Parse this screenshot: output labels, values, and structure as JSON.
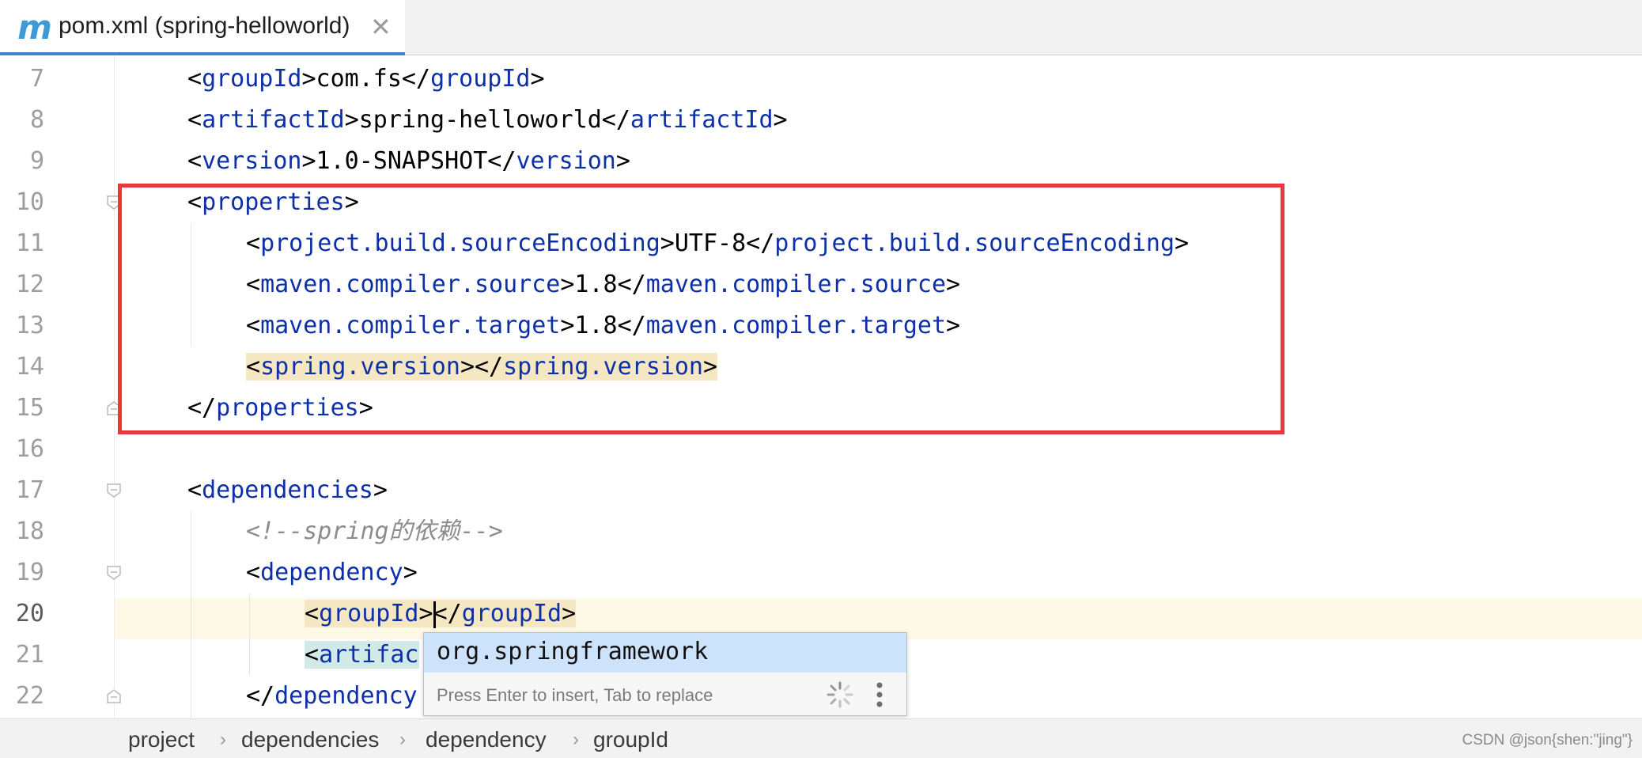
{
  "tab": {
    "icon": "maven-m-icon",
    "title": "pom.xml (spring-helloworld)",
    "close_glyph": "✕"
  },
  "editor": {
    "line_numbers": [
      "7",
      "8",
      "9",
      "10",
      "11",
      "12",
      "13",
      "14",
      "15",
      "16",
      "17",
      "18",
      "19",
      "20",
      "21",
      "22"
    ],
    "current_line": "20",
    "lines": {
      "l7": {
        "o": "<",
        "t1": "groupId",
        "c": ">com.fs</",
        "t2": "groupId",
        "e": ">"
      },
      "l8": {
        "o": "<",
        "t1": "artifactId",
        "c": ">spring-helloworld</",
        "t2": "artifactId",
        "e": ">"
      },
      "l9": {
        "o": "<",
        "t1": "version",
        "c": ">1.0-SNAPSHOT</",
        "t2": "version",
        "e": ">"
      },
      "l10": {
        "o": "<",
        "t1": "properties",
        "e": ">"
      },
      "l11": {
        "o": "<",
        "t1": "project.build.sourceEncoding",
        "c": ">UTF-8</",
        "t2": "project.build.sourceEncoding",
        "e": ">"
      },
      "l12": {
        "o": "<",
        "t1": "maven.compiler.source",
        "c": ">1.8</",
        "t2": "maven.compiler.source",
        "e": ">"
      },
      "l13": {
        "o": "<",
        "t1": "maven.compiler.target",
        "c": ">1.8</",
        "t2": "maven.compiler.target",
        "e": ">"
      },
      "l14": {
        "o": "<",
        "t1": "spring.version",
        "c": "></",
        "t2": "spring.version",
        "e": ">"
      },
      "l15": {
        "o": "</",
        "t1": "properties",
        "e": ">"
      },
      "l17": {
        "o": "<",
        "t1": "dependencies",
        "e": ">"
      },
      "l18": {
        "comment": "<!--spring的依赖-->"
      },
      "l19": {
        "o": "<",
        "t1": "dependency",
        "e": ">"
      },
      "l20": {
        "o": "<",
        "t1": "groupId",
        "c1": ">",
        "c2": "</",
        "t2": "groupId",
        "e": ">"
      },
      "l21": {
        "o": "<",
        "t1": "artifac"
      },
      "l22": {
        "o": "</",
        "t1": "dependency"
      }
    }
  },
  "autocomplete": {
    "item": "org.springframework",
    "hint": "Press Enter to insert, Tab to replace",
    "spinner_icon": "loading-spinner-icon",
    "menu_icon": "kebab-menu-icon"
  },
  "breadcrumbs": [
    "project",
    "dependencies",
    "dependency",
    "groupId"
  ],
  "watermark": "CSDN @json{shen:\"jing\"}",
  "colors": {
    "tag": "#0d2fa8",
    "comment": "#8c8c8c",
    "highlight": "#f5e7c2",
    "current_line": "#fdf9e6",
    "selection_box": "#e8383d",
    "autocomplete_selected": "#cde3fb",
    "tab_underline": "#4083c9"
  }
}
